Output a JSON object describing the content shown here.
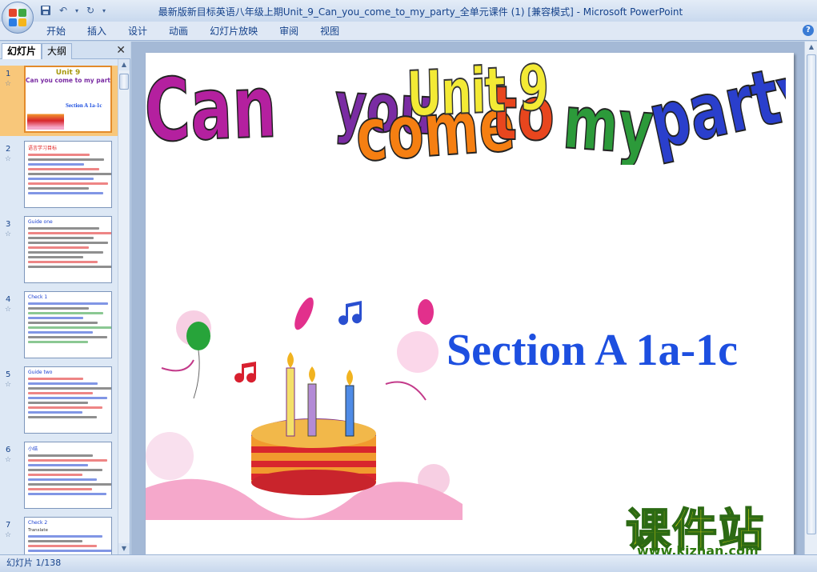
{
  "window": {
    "title": "最新版新目标英语八年级上期Unit_9_Can_you_come_to_my_party_全单元课件 (1) [兼容模式] - Microsoft PowerPoint"
  },
  "ribbon": {
    "tabs": [
      "开始",
      "插入",
      "设计",
      "动画",
      "幻灯片放映",
      "审阅",
      "视图"
    ]
  },
  "side_panel": {
    "tab_slides": "幻灯片",
    "tab_outline": "大纲",
    "thumbnails": [
      {
        "number": "1",
        "selected": true
      },
      {
        "number": "2",
        "selected": false
      },
      {
        "number": "3",
        "selected": false
      },
      {
        "number": "4",
        "selected": false
      },
      {
        "number": "5",
        "selected": false
      },
      {
        "number": "6",
        "selected": false
      },
      {
        "number": "7",
        "selected": false
      }
    ],
    "thumb_text": {
      "t1_unit": "Unit 9",
      "t1_title": "Can you come to my party?",
      "t1_section": "Section A 1a-1c",
      "t2_head": "语言学习目标",
      "t3_head": "Guide one",
      "t4_head": "Check 1",
      "t5_head": "Guide two",
      "t6_head": "小结",
      "t7_head": "Check 2",
      "t7_line": "Translate"
    }
  },
  "slide": {
    "unit": "Unit 9",
    "title_words": [
      {
        "text": "Can",
        "color": "#b4209f"
      },
      {
        "text": "you",
        "color": "#7a2ca3"
      },
      {
        "text": "come",
        "color": "#f57f12"
      },
      {
        "text": "to",
        "color": "#e8461e"
      },
      {
        "text": "my",
        "color": "#2c9a3a"
      },
      {
        "text": "party?",
        "color": "#2a3fcc"
      }
    ],
    "section": "Section A 1a-1c",
    "watermark_cn": "课件站",
    "watermark_url": "www.kjzhan.com"
  },
  "status": {
    "slide_counter": "幻灯片 1/138"
  },
  "colors": {
    "office_logo": [
      "#e3462b",
      "#3fa844",
      "#2b7de3",
      "#f5b51b"
    ]
  },
  "icons": {
    "save": "save-icon",
    "undo": "undo-icon",
    "redo": "redo-icon",
    "help": "help-icon",
    "close": "close-icon"
  }
}
